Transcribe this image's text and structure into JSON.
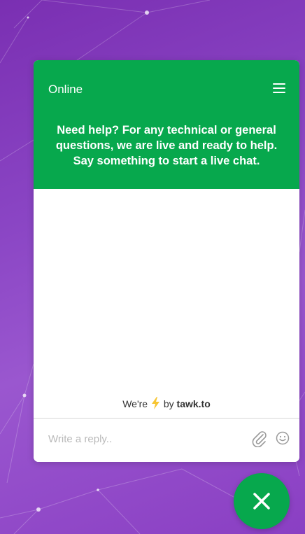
{
  "widget": {
    "status": "Online",
    "header_message": "Need help? For any technical or general questions, we are live and ready to help. Say something to start a live chat.",
    "branding": {
      "prefix": "We're",
      "by": "by",
      "brand": "tawk.to"
    },
    "reply": {
      "placeholder": "Write a reply.."
    }
  },
  "icons": {
    "menu": "hamburger-menu-icon",
    "bolt": "lightning-bolt-icon",
    "attach": "paperclip-icon",
    "emoji": "smiley-icon",
    "close": "close-icon"
  },
  "colors": {
    "brand_green": "#07a84d",
    "background_purple": "#8a45c4",
    "bolt_yellow": "#f7c531",
    "icon_gray": "#9a9a9a"
  }
}
